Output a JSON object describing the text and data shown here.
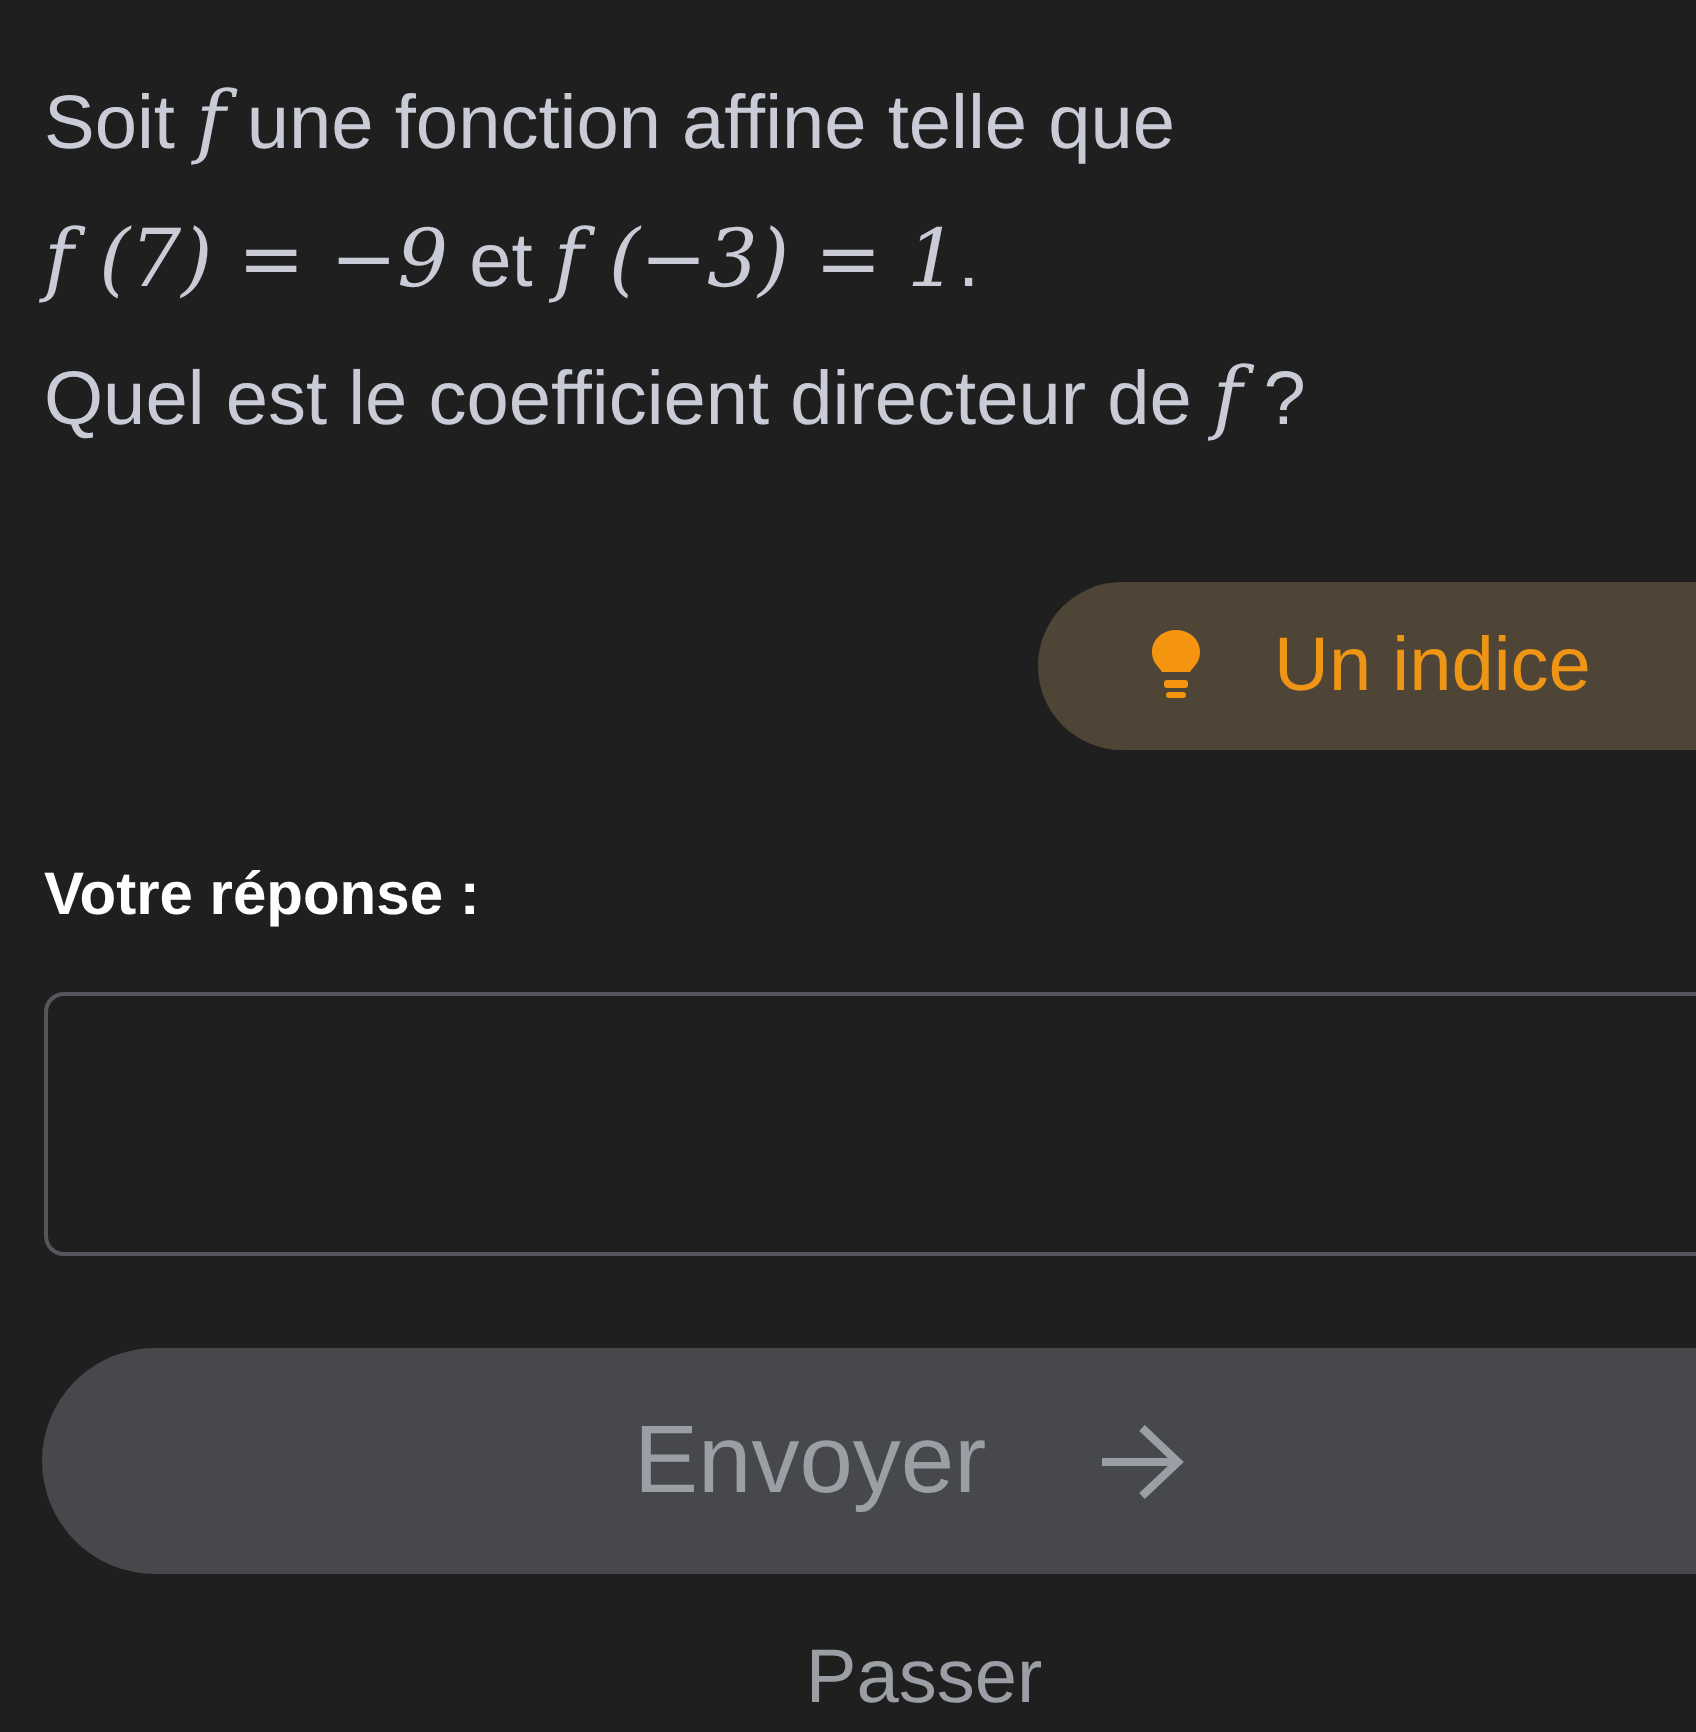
{
  "question": [
    [
      {
        "kind": "text",
        "text": "Soit "
      },
      {
        "kind": "math",
        "text": "f"
      },
      {
        "kind": "text",
        "text": " une fonction affine telle que"
      }
    ],
    [
      {
        "kind": "math",
        "text": "f (7) = −9"
      },
      {
        "kind": "text",
        "text": " et "
      },
      {
        "kind": "math",
        "text": "f (−3) = 1"
      },
      {
        "kind": "text",
        "text": "."
      }
    ],
    [
      {
        "kind": "text",
        "text": "Quel est le coefficient directeur de "
      },
      {
        "kind": "math",
        "text": "f"
      },
      {
        "kind": "text",
        "text": " ?"
      }
    ]
  ],
  "hint_button": {
    "label": "Un indice"
  },
  "answer": {
    "label": "Votre réponse :"
  },
  "submit_button": {
    "label": "Envoyer"
  },
  "skip_link": {
    "label": "Passer"
  }
}
